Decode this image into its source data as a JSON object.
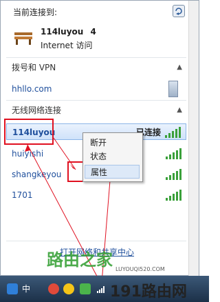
{
  "header": {
    "title": "当前连接到:",
    "refresh_icon": "refresh-icon"
  },
  "current": {
    "name": "114luyou",
    "number": "4",
    "status": "Internet 访问"
  },
  "dialup": {
    "header": "拨号和 VPN",
    "items": [
      {
        "label": "hhllo.com"
      }
    ]
  },
  "wireless": {
    "header": "无线网络连接",
    "networks": [
      {
        "name": "114luyou",
        "status": "已连接"
      },
      {
        "name": "huiyishi"
      },
      {
        "name": "shangkeyou"
      },
      {
        "name": "1701"
      }
    ]
  },
  "context_menu": {
    "items": [
      "断开",
      "状态",
      "属性"
    ]
  },
  "footer": {
    "link": "打开网络和共享中心"
  },
  "taskbar": {
    "ime_label": "中"
  },
  "watermark": {
    "main": "路由之家",
    "brand": "191路由网",
    "url": "LUYOUQI520.COM"
  },
  "colors": {
    "accent_red": "#e01020",
    "link_blue": "#1f4f9c",
    "signal_green": "#3aa03a"
  }
}
